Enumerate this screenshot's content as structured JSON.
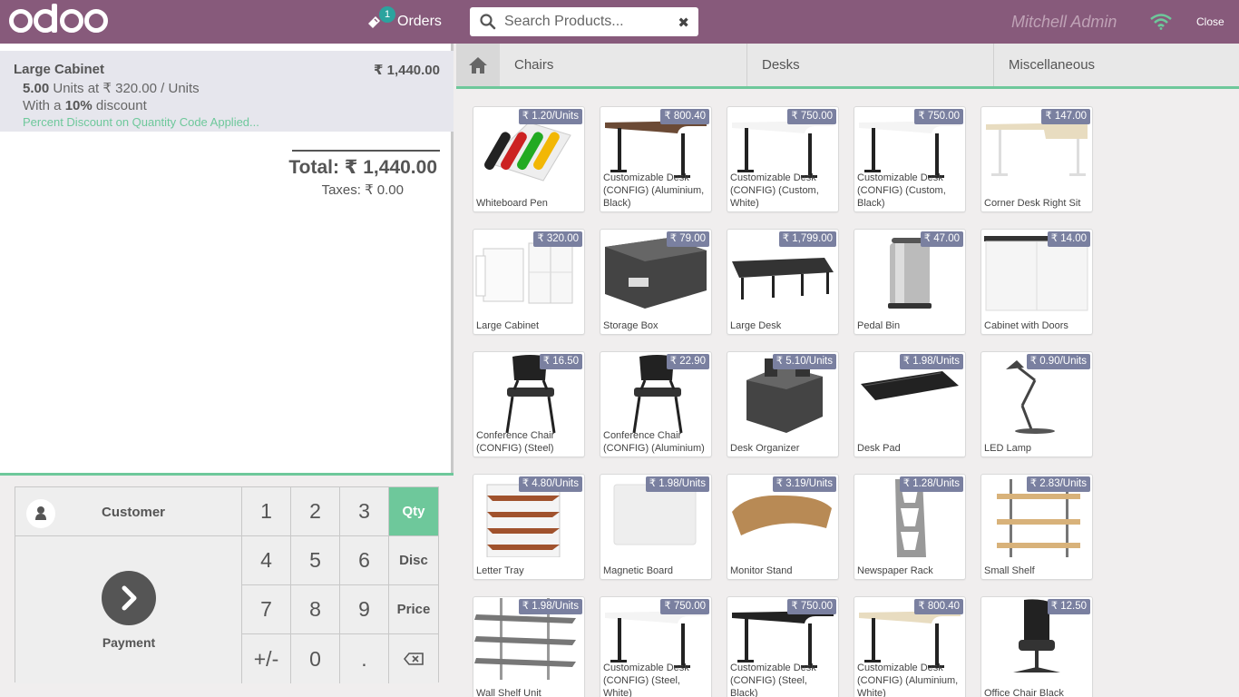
{
  "header": {
    "logo_text": "odoo",
    "orders_label": "Orders",
    "orders_count": "1",
    "search_placeholder": "Search Products...",
    "cashier": "Mitchell Admin",
    "close_label": "Close"
  },
  "order": {
    "line": {
      "name": "Large Cabinet",
      "price": "₹ 1,440.00",
      "qty": "5.00",
      "unit_text": "Units at ₹ 320.00 / Units",
      "discount_prefix": "With a",
      "discount_value": "10%",
      "discount_suffix": "discount",
      "promo": "Percent Discount on Quantity Code Applied..."
    },
    "total_label": "Total: ₹ 1,440.00",
    "taxes_label": "Taxes: ₹ 0.00"
  },
  "controls": {
    "customer_label": "Customer",
    "payment_label": "Payment",
    "keys": [
      "1",
      "2",
      "3",
      "Qty",
      "4",
      "5",
      "6",
      "Disc",
      "7",
      "8",
      "9",
      "Price",
      "+/-",
      "0",
      ".",
      "⌫"
    ],
    "active_mode": "Qty"
  },
  "categories": [
    "Chairs",
    "Desks",
    "Miscellaneous"
  ],
  "products": [
    {
      "name": "Whiteboard Pen",
      "price": "₹ 1.20/Units"
    },
    {
      "name": "Customizable Desk (CONFIG) (Aluminium, Black)",
      "price": "₹ 800.40"
    },
    {
      "name": "Customizable Desk (CONFIG) (Custom, White)",
      "price": "₹ 750.00"
    },
    {
      "name": "Customizable Desk (CONFIG) (Custom, Black)",
      "price": "₹ 750.00"
    },
    {
      "name": "Corner Desk Right Sit",
      "price": "₹ 147.00"
    },
    {
      "name": "Large Cabinet",
      "price": "₹ 320.00"
    },
    {
      "name": "Storage Box",
      "price": "₹ 79.00"
    },
    {
      "name": "Large Desk",
      "price": "₹ 1,799.00"
    },
    {
      "name": "Pedal Bin",
      "price": "₹ 47.00"
    },
    {
      "name": "Cabinet with Doors",
      "price": "₹ 14.00"
    },
    {
      "name": "Conference Chair (CONFIG) (Steel)",
      "price": "₹ 16.50"
    },
    {
      "name": "Conference Chair (CONFIG) (Aluminium)",
      "price": "₹ 22.90"
    },
    {
      "name": "Desk Organizer",
      "price": "₹ 5.10/Units"
    },
    {
      "name": "Desk Pad",
      "price": "₹ 1.98/Units"
    },
    {
      "name": "LED Lamp",
      "price": "₹ 0.90/Units"
    },
    {
      "name": "Letter Tray",
      "price": "₹ 4.80/Units"
    },
    {
      "name": "Magnetic Board",
      "price": "₹ 1.98/Units"
    },
    {
      "name": "Monitor Stand",
      "price": "₹ 3.19/Units"
    },
    {
      "name": "Newspaper Rack",
      "price": "₹ 1.28/Units"
    },
    {
      "name": "Small Shelf",
      "price": "₹ 2.83/Units"
    },
    {
      "name": "Wall Shelf Unit",
      "price": "₹ 1.98/Units"
    },
    {
      "name": "Customizable Desk (CONFIG) (Steel, White)",
      "price": "₹ 750.00"
    },
    {
      "name": "Customizable Desk (CONFIG) (Steel, Black)",
      "price": "₹ 750.00"
    },
    {
      "name": "Customizable Desk (CONFIG) (Aluminium, White)",
      "price": "₹ 800.40"
    },
    {
      "name": "Office Chair Black",
      "price": "₹ 12.50"
    }
  ]
}
